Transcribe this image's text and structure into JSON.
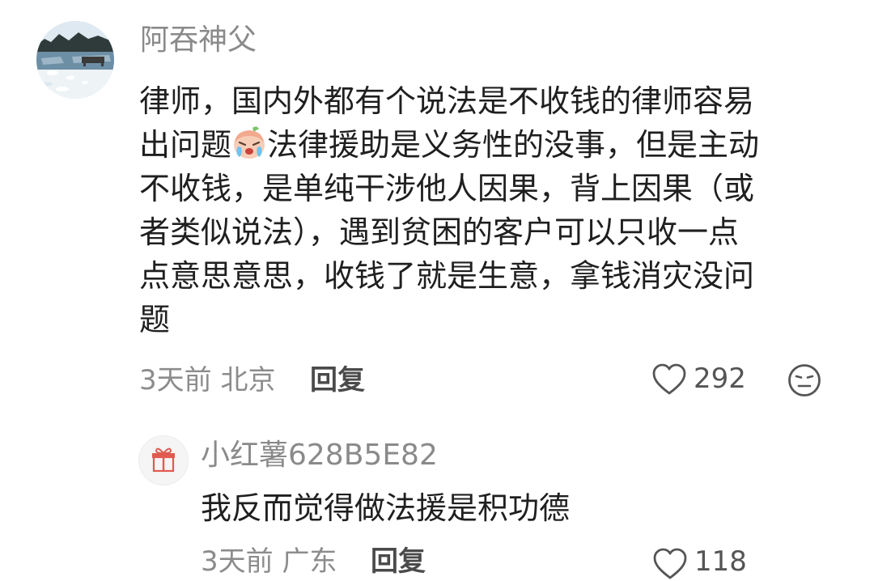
{
  "comment": {
    "username": "阿吞神父",
    "avatar": "winter-lake-avatar",
    "lines": [
      "律师，国内外都有个说法是不收钱的律师容易",
      "出问题",
      "法律援助是义务性的没事，但是主动",
      "不收钱，是单纯干涉他人因果，背上因果（或",
      "者类似说法），遇到贫困的客户可以只收一点",
      "点意思意思，收钱了就是生意，拿钱消灾没问",
      "题"
    ],
    "emoji": "crying-face-emoji",
    "time": "3天前",
    "location": "北京",
    "reply_label": "回复",
    "like_count": "292",
    "like_icon": "heart-icon",
    "dislike_icon": "dislike-face-icon"
  },
  "reply": {
    "avatar": "gift-icon",
    "username": "小红薯628B5E82",
    "text": "我反而觉得做法援是积功德",
    "meta_partial": "3天前 广东",
    "reply_label": "回复",
    "like_count": "118"
  },
  "colors": {
    "text": "#1f1f1f",
    "secondary": "#8a8a8a",
    "gift_red": "#e05b4f"
  }
}
